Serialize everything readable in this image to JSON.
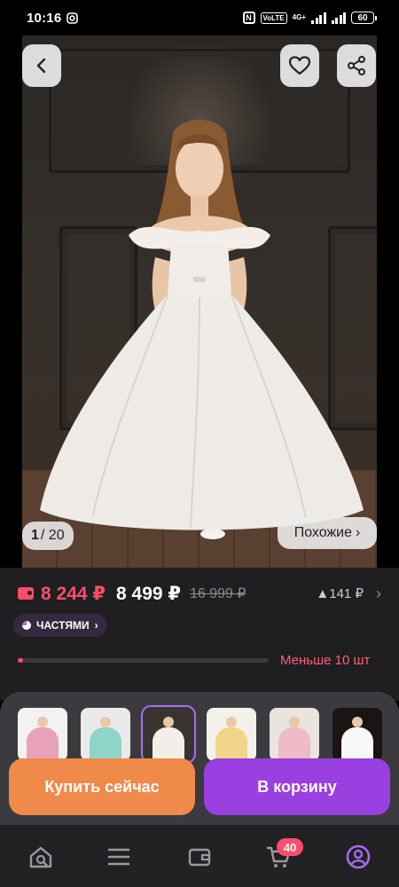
{
  "status_bar": {
    "time": "10:16",
    "nfc_label": "N",
    "volte_label": "VoLTE",
    "network_label": "4G+",
    "battery": "60"
  },
  "gallery": {
    "counter_current": "1",
    "counter_total": "/ 20",
    "similar_label": "Похожие",
    "similar_chevron": "›"
  },
  "icons": {
    "back": "chevron-left-icon",
    "favorite": "heart-icon",
    "share": "share-icon",
    "wallet": "wallet-icon",
    "parts": "parts-icon",
    "catalog": "search-home-icon",
    "menu": "menu-icon",
    "wallet_nav": "wallet-icon",
    "cart": "cart-icon",
    "profile": "profile-icon"
  },
  "price": {
    "wallet_price": "8 244 ₽",
    "price": "8 499 ₽",
    "old_price": "16 999 ₽",
    "change": "▲141 ₽",
    "chevron": "›"
  },
  "parts_badge": {
    "label": "ЧАСТЯМИ",
    "chevron": "›"
  },
  "stock": {
    "label": "Меньше 10 шт",
    "level": 0.02
  },
  "thumbnails": [
    {
      "dress_color": "#e7a2b8",
      "bg": "#f2f2f2",
      "selected": false
    },
    {
      "dress_color": "#8fd3c9",
      "bg": "#eaeaea",
      "selected": false
    },
    {
      "dress_color": "#f3eee8",
      "bg": "#3a3430",
      "selected": true
    },
    {
      "dress_color": "#f1d58a",
      "bg": "#f4f1ea",
      "selected": false
    },
    {
      "dress_color": "#f0b9c7",
      "bg": "#e9e4de",
      "selected": false
    },
    {
      "dress_color": "#f8f8f8",
      "bg": "#1a1412",
      "selected": false
    }
  ],
  "actions": {
    "buy_now": "Купить сейчас",
    "add_to_cart": "В корзину"
  },
  "bottom_nav": {
    "cart_count": "40"
  },
  "colors": {
    "accent_red": "#ff4d6a",
    "buy_orange": "#f08a4b",
    "cart_purple": "#9a3fe0",
    "profile_purple": "#a56cf0"
  }
}
